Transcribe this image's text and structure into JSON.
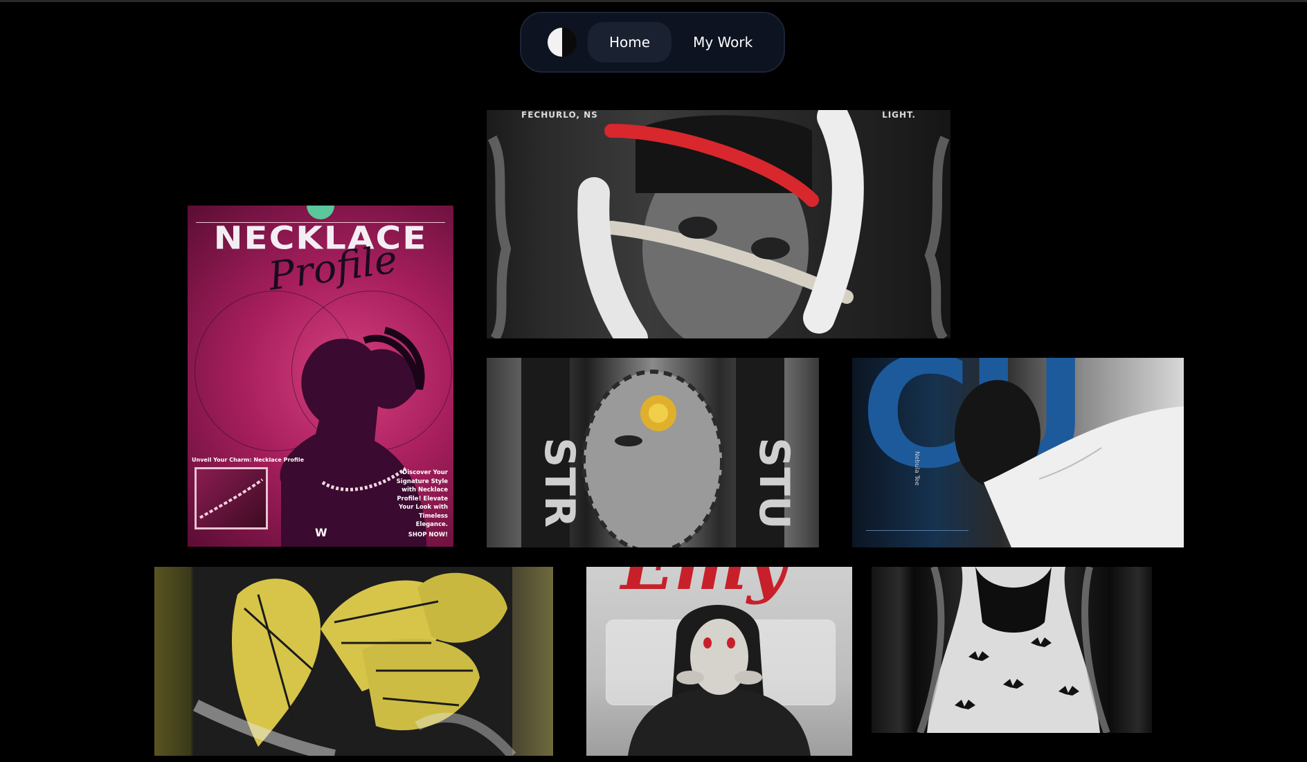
{
  "nav": {
    "theme_toggle_icon": "half-moon-contrast-icon",
    "home_label": "Home",
    "mywork_label": "My Work"
  },
  "gallery": {
    "necklace": {
      "headline": "NECKLACE",
      "subhead": "Profile",
      "caption": "Unveil Your Charm: Necklace Profile",
      "blurb_lines": [
        "Discover Your",
        "Signature Style",
        "with Necklace",
        "Profile! Elevate",
        "Your Look with",
        "Timeless",
        "Elegance."
      ],
      "shop": "SHOP NOW!",
      "logo": "W"
    },
    "rope": {
      "corner_left": "FECHURLO, NS",
      "corner_right": "LIGHT."
    },
    "bluetype": {
      "big_letters": "CU",
      "vertical_text": "Nebula Tee"
    },
    "sheep": {
      "title": "Emy"
    }
  },
  "colors": {
    "background": "#000000",
    "nav_bg": "#0d1320",
    "nav_active": "#1a2232",
    "accent_pink": "#a81f5e",
    "accent_blue": "#1d5a9c",
    "accent_red": "#c8202a",
    "accent_yellow": "#d8c64a"
  }
}
